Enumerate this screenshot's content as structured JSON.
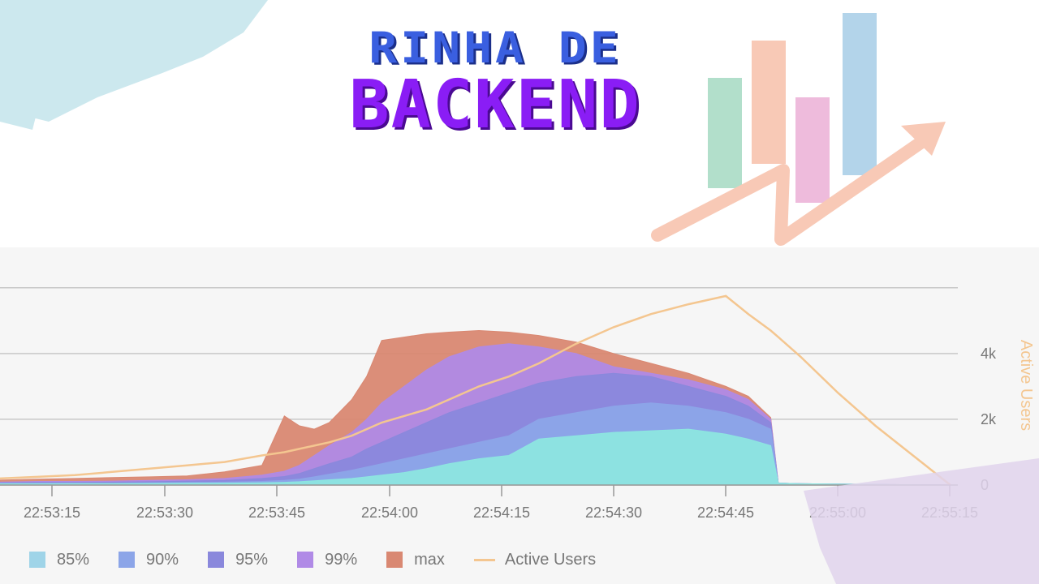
{
  "header": {
    "line1": "RINHA DE",
    "line2": "BACKEND"
  },
  "colors": {
    "p85": "#9fd4e8",
    "p90": "#8ca5e8",
    "p95": "#8a88dc",
    "p99": "#b08ae6",
    "max": "#d98872",
    "active_users": "#f4c690",
    "teal_fill": "#8de6e0",
    "grid": "#cccccc"
  },
  "legend": [
    {
      "label": "85%",
      "color": "#9fd4e8",
      "kind": "box"
    },
    {
      "label": "90%",
      "color": "#8ca5e8",
      "kind": "box"
    },
    {
      "label": "95%",
      "color": "#8a88dc",
      "kind": "box"
    },
    {
      "label": "99%",
      "color": "#b08ae6",
      "kind": "box"
    },
    {
      "label": "max",
      "color": "#d98872",
      "kind": "box"
    },
    {
      "label": "Active Users",
      "color": "#f4c690",
      "kind": "line"
    }
  ],
  "chart_data": {
    "type": "area",
    "xlabel": "",
    "ylabel": "",
    "y2label": "Active Users",
    "x_ticks": [
      "22:53:15",
      "22:53:30",
      "22:53:45",
      "22:54:00",
      "22:54:15",
      "22:54:30",
      "22:54:45",
      "22:55:00",
      "22:55:15"
    ],
    "x_range": [
      "22:53:08",
      "22:55:15"
    ],
    "y2_ticks": [
      "0",
      "2k",
      "4k"
    ],
    "y2_range": [
      0,
      6000
    ],
    "y_range": [
      0,
      6000
    ],
    "grid": true,
    "legend_position": "bottom",
    "x": [
      "22:53:08",
      "22:53:13",
      "22:53:18",
      "22:53:23",
      "22:53:28",
      "22:53:33",
      "22:53:38",
      "22:53:43",
      "22:53:46",
      "22:53:48",
      "22:53:50",
      "22:53:52",
      "22:53:55",
      "22:53:57",
      "22:53:59",
      "22:54:02",
      "22:54:05",
      "22:54:08",
      "22:54:12",
      "22:54:16",
      "22:54:20",
      "22:54:25",
      "22:54:30",
      "22:54:35",
      "22:54:40",
      "22:54:45",
      "22:54:48",
      "22:54:51",
      "22:54:52",
      "22:54:55",
      "22:55:00",
      "22:55:05",
      "22:55:10",
      "22:55:15"
    ],
    "series": [
      {
        "name": "85%",
        "values": [
          40,
          40,
          45,
          45,
          50,
          55,
          60,
          70,
          85,
          100,
          130,
          160,
          200,
          250,
          300,
          380,
          500,
          650,
          800,
          900,
          1400,
          1500,
          1600,
          1650,
          1700,
          1550,
          1400,
          1200,
          60,
          40,
          30,
          20,
          10,
          0
        ]
      },
      {
        "name": "90%",
        "values": [
          50,
          55,
          60,
          60,
          70,
          80,
          90,
          110,
          140,
          180,
          250,
          330,
          450,
          550,
          650,
          800,
          950,
          1100,
          1300,
          1500,
          2000,
          2200,
          2400,
          2500,
          2400,
          2200,
          2000,
          1700,
          60,
          40,
          30,
          20,
          10,
          0
        ]
      },
      {
        "name": "95%",
        "values": [
          70,
          80,
          80,
          90,
          100,
          120,
          140,
          200,
          260,
          350,
          500,
          650,
          850,
          1100,
          1300,
          1600,
          1900,
          2200,
          2500,
          2800,
          3100,
          3300,
          3400,
          3300,
          3000,
          2700,
          2400,
          1900,
          60,
          40,
          30,
          20,
          10,
          0
        ]
      },
      {
        "name": "99%",
        "values": [
          90,
          110,
          110,
          120,
          140,
          160,
          200,
          300,
          420,
          600,
          900,
          1200,
          1600,
          2000,
          2500,
          3000,
          3500,
          3900,
          4200,
          4300,
          4200,
          4000,
          3600,
          3400,
          3200,
          2900,
          2600,
          2000,
          60,
          40,
          30,
          20,
          10,
          0
        ]
      },
      {
        "name": "max",
        "values": [
          150,
          180,
          200,
          230,
          250,
          280,
          400,
          600,
          2100,
          1800,
          1700,
          1900,
          2600,
          3300,
          4400,
          4500,
          4600,
          4650,
          4700,
          4650,
          4550,
          4350,
          4000,
          3700,
          3400,
          3000,
          2700,
          2050,
          60,
          40,
          30,
          20,
          10,
          0
        ]
      },
      {
        "name": "Active Users",
        "values": [
          200,
          250,
          300,
          400,
          500,
          600,
          700,
          900,
          1000,
          1100,
          1200,
          1300,
          1500,
          1700,
          1900,
          2100,
          2300,
          2600,
          3000,
          3300,
          3700,
          4300,
          4800,
          5200,
          5500,
          5750,
          5200,
          4700,
          4500,
          3900,
          2800,
          1800,
          900,
          0
        ]
      }
    ]
  }
}
